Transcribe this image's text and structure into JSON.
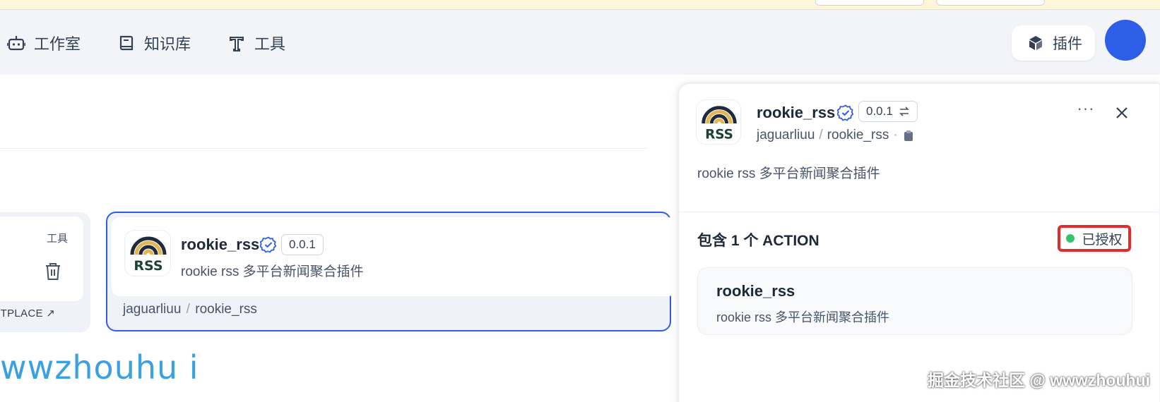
{
  "nav": {
    "items": [
      {
        "label": "工作室",
        "icon": "robot-icon"
      },
      {
        "label": "知识库",
        "icon": "book-icon"
      },
      {
        "label": "工具",
        "icon": "tool-icon"
      }
    ],
    "plugin_label": "插件",
    "plugin_icon": "cube-icon"
  },
  "left_card": {
    "tag": "工具",
    "marketplace_label": "KETPLACE ↗"
  },
  "plugin_card": {
    "title": "rookie_rss",
    "version": "0.0.1",
    "description": "rookie rss 多平台新闻聚合插件",
    "author": "jaguarliuu",
    "repo": "rookie_rss",
    "logo_text": "RSS"
  },
  "drawer": {
    "title": "rookie_rss",
    "version": "0.0.1",
    "author": "jaguarliuu",
    "repo": "rookie_rss",
    "description": "rookie rss 多平台新闻聚合插件",
    "more_label": "···",
    "action_heading": "包含 1 个 ACTION",
    "auth_label": "已授权",
    "actions": [
      {
        "name": "rookie_rss",
        "description": "rookie rss 多平台新闻聚合插件"
      }
    ]
  },
  "watermark": {
    "left_text": "wwzhouhu i",
    "right_text": "掘金技术社区 @ wwwzhouhui"
  },
  "colors": {
    "accent": "#2d5ee8",
    "auth_green": "#35c46c",
    "highlight_red": "#e32b2b",
    "watermark_blue": "#3aa0e0",
    "banner_yellow": "#fdf6d8"
  }
}
